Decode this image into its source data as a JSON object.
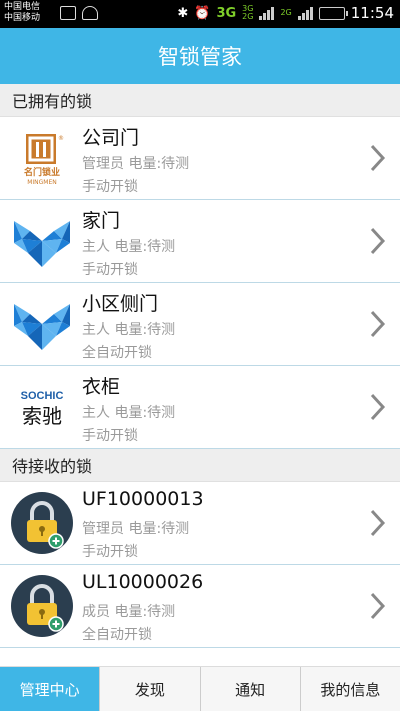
{
  "statusbar": {
    "carrier1": "中国电信",
    "carrier2": "中国移动",
    "net1": "3G",
    "net2a": "3G",
    "net2b": "2G",
    "net3": "2G",
    "time": "11:54"
  },
  "header": {
    "title": "智锁管家"
  },
  "owned": {
    "label": "已拥有的锁",
    "items": [
      {
        "name": "公司门",
        "meta": "管理员  电量:待测",
        "mode": "手动开锁",
        "logo": "mingmen-logo"
      },
      {
        "name": "家门",
        "meta": "主人  电量:待测",
        "mode": "手动开锁",
        "logo": "blue-triangle-logo"
      },
      {
        "name": "小区侧门",
        "meta": "主人  电量:待测",
        "mode": "全自动开锁",
        "logo": "blue-triangle-logo"
      },
      {
        "name": "衣柜",
        "meta": "主人  电量:待测",
        "mode": "手动开锁",
        "logo": "sochic-logo"
      }
    ]
  },
  "pending": {
    "label": "待接收的锁",
    "items": [
      {
        "name": "UF10000013",
        "meta": "管理员  电量:待测",
        "mode": "手动开锁",
        "logo": "padlock-add-icon"
      },
      {
        "name": "UL10000026",
        "meta": "成员  电量:待测",
        "mode": "全自动开锁",
        "logo": "padlock-add-icon"
      }
    ]
  },
  "logos": {
    "mingmen_cn": "名门锁业",
    "mingmen_en": "MINGMEN",
    "sochic_en": "SOCHIC",
    "sochic_cn": "索驰"
  },
  "nav": {
    "tabs": [
      "管理中心",
      "发现",
      "通知",
      "我的信息"
    ],
    "active": 0
  },
  "colors": {
    "accent": "#3fb6e6",
    "logo_blue": "#1e7fd6",
    "lock_gold": "#f2c233",
    "lock_badge": "#2e9e6b"
  }
}
